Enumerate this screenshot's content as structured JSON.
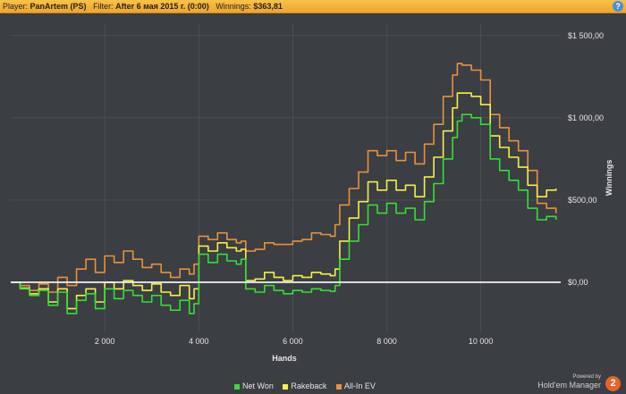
{
  "filter_bar": {
    "player_label": "Player:",
    "player_value": "PanArtem (PS)",
    "filter_label": "Filter:",
    "filter_value": "After 6 мая 2015 г. (0:00)",
    "winnings_label": "Winnings:",
    "winnings_value": "$363,81",
    "help_label": "?"
  },
  "colors": {
    "net_won": "#33e033",
    "rakeback": "#f5f046",
    "allin_ev": "#e8923a",
    "zero_line": "#ffffff",
    "grid": "#55585d"
  },
  "chart_data": {
    "type": "line",
    "xlabel": "Hands",
    "ylabel": "Winnings",
    "xlim": [
      0,
      11700
    ],
    "ylim": [
      -310,
      1575
    ],
    "x_ticks": [
      2000,
      4000,
      6000,
      8000,
      10000
    ],
    "x_tick_labels": [
      "2 000",
      "4 000",
      "6 000",
      "8 000",
      "10 000"
    ],
    "y_ticks": [
      0,
      500,
      1000,
      1500
    ],
    "y_tick_labels": [
      "$0,00",
      "$500,00",
      "$1 000,00",
      "$1 500,00"
    ],
    "grid": true,
    "legend_position": "bottom",
    "x": [
      0,
      200,
      400,
      600,
      800,
      1000,
      1200,
      1400,
      1600,
      1800,
      2000,
      2200,
      2400,
      2600,
      2800,
      3000,
      3200,
      3400,
      3600,
      3800,
      3900,
      4000,
      4200,
      4400,
      4600,
      4800,
      4900,
      5000,
      5200,
      5400,
      5600,
      5800,
      6000,
      6200,
      6400,
      6600,
      6800,
      6900,
      7000,
      7200,
      7400,
      7600,
      7800,
      8000,
      8200,
      8400,
      8600,
      8800,
      9000,
      9200,
      9400,
      9500,
      9600,
      9800,
      10000,
      10200,
      10400,
      10600,
      10800,
      11000,
      11200,
      11400,
      11600
    ],
    "series": [
      {
        "name": "Net Won",
        "values": [
          0,
          -40,
          -80,
          -50,
          -140,
          -60,
          -190,
          -110,
          -70,
          -160,
          -40,
          -100,
          -50,
          -80,
          -120,
          -80,
          -140,
          -170,
          -110,
          -190,
          -130,
          170,
          120,
          170,
          130,
          110,
          140,
          -40,
          -60,
          -20,
          -50,
          -70,
          -50,
          -60,
          -40,
          -50,
          -55,
          -20,
          140,
          250,
          350,
          470,
          420,
          480,
          420,
          450,
          380,
          490,
          600,
          750,
          880,
          980,
          1020,
          1000,
          960,
          750,
          680,
          620,
          560,
          450,
          380,
          400,
          380
        ]
      },
      {
        "name": "Rakeback",
        "values": [
          0,
          -35,
          -70,
          -40,
          -120,
          -40,
          -160,
          -80,
          -40,
          -120,
          0,
          -40,
          10,
          -20,
          -50,
          -10,
          -60,
          -80,
          -20,
          -100,
          -40,
          220,
          190,
          240,
          210,
          190,
          200,
          10,
          20,
          60,
          30,
          10,
          40,
          30,
          60,
          50,
          40,
          80,
          250,
          390,
          490,
          610,
          560,
          620,
          560,
          590,
          520,
          640,
          760,
          920,
          1060,
          1150,
          1150,
          1130,
          1080,
          890,
          820,
          760,
          700,
          590,
          520,
          560,
          570
        ]
      },
      {
        "name": "All-In EV",
        "values": [
          0,
          -20,
          -50,
          -10,
          -60,
          30,
          -20,
          80,
          140,
          60,
          160,
          120,
          190,
          140,
          90,
          110,
          60,
          30,
          80,
          50,
          110,
          280,
          260,
          300,
          260,
          240,
          250,
          190,
          200,
          240,
          230,
          230,
          250,
          260,
          300,
          290,
          280,
          350,
          470,
          570,
          670,
          800,
          770,
          800,
          740,
          790,
          720,
          840,
          960,
          1130,
          1260,
          1330,
          1320,
          1290,
          1230,
          1020,
          940,
          860,
          800,
          680,
          480,
          450,
          420
        ]
      }
    ]
  },
  "branding": {
    "powered_by": "Powered by",
    "product": "Hold'em Manager",
    "badge": "2"
  }
}
